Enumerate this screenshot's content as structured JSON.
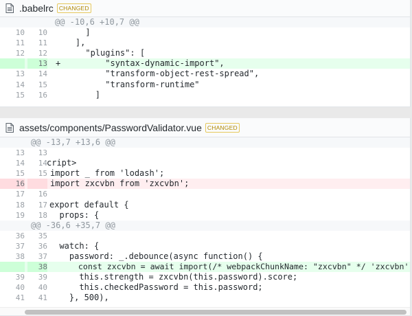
{
  "files": [
    {
      "name": ".babelrc",
      "badge": "CHANGED",
      "icon": "file-text-icon",
      "lines": [
        {
          "type": "hunk",
          "old": "",
          "new": "",
          "marker": "",
          "code": "@@ -10,6 +10,7 @@"
        },
        {
          "type": "ctx",
          "old": "10",
          "new": "10",
          "marker": "",
          "code": "      ]"
        },
        {
          "type": "ctx",
          "old": "11",
          "new": "11",
          "marker": "",
          "code": "    ],"
        },
        {
          "type": "ctx",
          "old": "12",
          "new": "12",
          "marker": "",
          "code": "      \"plugins\": ["
        },
        {
          "type": "add",
          "old": "",
          "new": "13",
          "marker": "+",
          "code": "          \"syntax-dynamic-import\","
        },
        {
          "type": "ctx",
          "old": "13",
          "new": "14",
          "marker": "",
          "code": "          \"transform-object-rest-spread\","
        },
        {
          "type": "ctx",
          "old": "14",
          "new": "15",
          "marker": "",
          "code": "          \"transform-runtime\""
        },
        {
          "type": "ctx",
          "old": "15",
          "new": "16",
          "marker": "",
          "code": "        ]"
        }
      ]
    },
    {
      "name": "assets/components/PasswordValidator.vue",
      "badge": "CHANGED",
      "icon": "file-text-icon",
      "lines": [
        {
          "type": "hunk",
          "old": "",
          "new": "",
          "marker": "",
          "code": "@@ -13,7 +13,6 @@"
        },
        {
          "type": "ctx",
          "old": "13",
          "new": "13",
          "marker": "",
          "code": ""
        },
        {
          "type": "ctx",
          "old": "14",
          "new": "14",
          "marker": "",
          "code": "cript>"
        },
        {
          "type": "ctx",
          "old": "15",
          "new": "15",
          "marker": "",
          "code": "import _ from 'lodash';"
        },
        {
          "type": "del",
          "old": "16",
          "new": "",
          "marker": "",
          "code": "import zxcvbn from 'zxcvbn';"
        },
        {
          "type": "ctx",
          "old": "17",
          "new": "16",
          "marker": "",
          "code": ""
        },
        {
          "type": "ctx",
          "old": "18",
          "new": "17",
          "marker": "",
          "code": "export default {"
        },
        {
          "type": "ctx",
          "old": "19",
          "new": "18",
          "marker": "",
          "code": "  props: {"
        },
        {
          "type": "hunk",
          "old": "",
          "new": "",
          "marker": "",
          "code": "@@ -36,6 +35,7 @@"
        },
        {
          "type": "ctx",
          "old": "36",
          "new": "35",
          "marker": "",
          "code": ""
        },
        {
          "type": "ctx",
          "old": "37",
          "new": "36",
          "marker": "",
          "code": "  watch: {"
        },
        {
          "type": "ctx",
          "old": "38",
          "new": "37",
          "marker": "",
          "code": "    password: _.debounce(async function() {"
        },
        {
          "type": "add",
          "old": "",
          "new": "38",
          "marker": "",
          "code": "      const zxcvbn = await import(/* webpackChunkName: \"zxcvbn\" */ 'zxcvbn');"
        },
        {
          "type": "ctx",
          "old": "39",
          "new": "39",
          "marker": "",
          "code": "      this.strength = zxcvbn(this.password).score;"
        },
        {
          "type": "ctx",
          "old": "40",
          "new": "40",
          "marker": "",
          "code": "      this.checkedPassword = this.password;"
        },
        {
          "type": "ctx",
          "old": "41",
          "new": "41",
          "marker": "",
          "code": "    }, 500),"
        }
      ]
    }
  ]
}
